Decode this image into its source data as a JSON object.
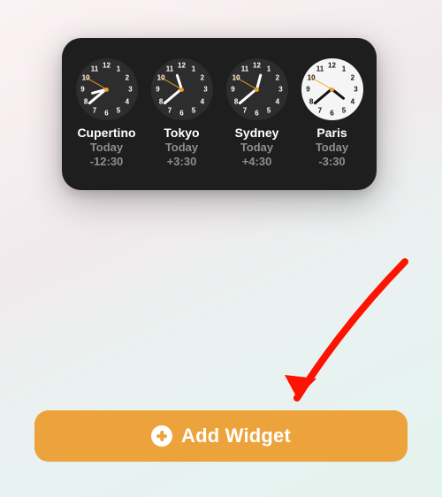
{
  "widget": {
    "clocks": [
      {
        "city": "Cupertino",
        "day_label": "Today",
        "offset": "-12:30",
        "mode": "dark",
        "hour_angle": 255,
        "minute_angle": 230,
        "second_angle": 300
      },
      {
        "city": "Tokyo",
        "day_label": "Today",
        "offset": "+3:30",
        "mode": "dark",
        "hour_angle": 342,
        "minute_angle": 230,
        "second_angle": 300
      },
      {
        "city": "Sydney",
        "day_label": "Today",
        "offset": "+4:30",
        "mode": "dark",
        "hour_angle": 15,
        "minute_angle": 230,
        "second_angle": 300
      },
      {
        "city": "Paris",
        "day_label": "Today",
        "offset": "-3:30",
        "mode": "light",
        "hour_angle": 128,
        "minute_angle": 230,
        "second_angle": 300
      }
    ]
  },
  "button": {
    "add_widget_label": "Add Widget"
  },
  "icons": {
    "plus_circle": "plus-circle-icon",
    "arrow": "arrow-icon"
  },
  "colors": {
    "accent_orange": "#eda33b",
    "arrow_red": "#fd1302",
    "card_bg": "#1e1e1e",
    "second_hand": "#f5a623"
  }
}
